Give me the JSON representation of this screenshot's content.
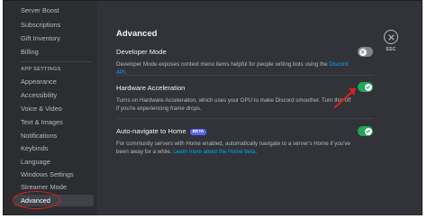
{
  "sidebar": {
    "items_top": [
      {
        "label": "Server Boost"
      },
      {
        "label": "Subscriptions"
      },
      {
        "label": "Gift Inventory"
      },
      {
        "label": "Billing"
      }
    ],
    "section_header": "APP SETTINGS",
    "items_app": [
      {
        "label": "Appearance"
      },
      {
        "label": "Accessibility"
      },
      {
        "label": "Voice & Video"
      },
      {
        "label": "Text & Images"
      },
      {
        "label": "Notifications"
      },
      {
        "label": "Keybinds"
      },
      {
        "label": "Language"
      },
      {
        "label": "Windows Settings"
      },
      {
        "label": "Streamer Mode"
      },
      {
        "label": "Advanced"
      }
    ],
    "active": "Advanced"
  },
  "main": {
    "title": "Advanced",
    "settings": [
      {
        "title": "Developer Mode",
        "desc_text": "Developer Mode exposes context menu items helpful for people writing bots using the ",
        "desc_link": "Discord API",
        "desc_end": ".",
        "enabled": false
      },
      {
        "title": "Hardware Acceleration",
        "desc_text": "Turns on Hardware Acceleration, which uses your GPU to make Discord smoother. Turn this off if you're experiencing frame drops.",
        "enabled": true
      },
      {
        "title": "Auto-navigate to Home",
        "badge": "BETA",
        "desc_text": "For community servers with Home enabled, automatically navigate to a server's Home if you've been away for a while. ",
        "desc_link": "Learn more about the Home beta.",
        "enabled": true
      }
    ]
  },
  "close": {
    "label": "ESC"
  },
  "colors": {
    "background": "#313338",
    "sidebar": "#2b2d31",
    "toggle_on": "#23a55a",
    "toggle_off": "#80848e",
    "link": "#00a8fc",
    "beta_badge": "#5865f2",
    "annotation": "#e0201b"
  },
  "icons": {
    "close": "x-icon",
    "toggle_check": "check-icon",
    "toggle_off": "x-icon"
  }
}
